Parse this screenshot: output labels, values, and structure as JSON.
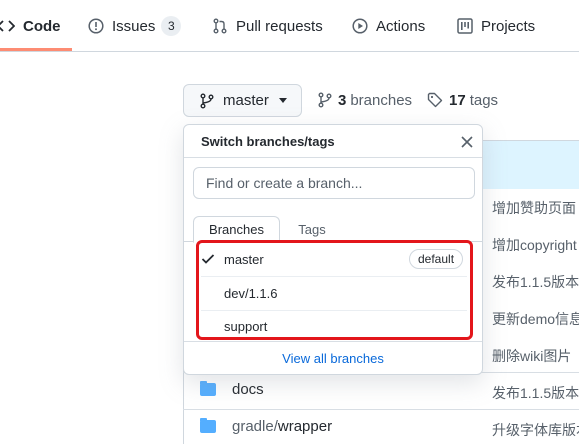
{
  "nav": {
    "code_label": "Code",
    "issues_label": "Issues",
    "issues_count": "3",
    "pulls_label": "Pull requests",
    "actions_label": "Actions",
    "projects_label": "Projects",
    "active_color": "#fd8c73"
  },
  "branch_bar": {
    "current_branch": "master",
    "branches_count": "3",
    "branches_label": "branches",
    "tags_count": "17",
    "tags_label": "tags"
  },
  "dropdown": {
    "title": "Switch branches/tags",
    "filter_placeholder": "Find or create a branch...",
    "tabs": [
      {
        "label": "Branches",
        "selected": true
      },
      {
        "label": "Tags",
        "selected": false
      }
    ],
    "items": [
      {
        "label": "master",
        "checked": true,
        "badge": "default"
      },
      {
        "label": "dev/1.1.6",
        "checked": false,
        "badge": ""
      },
      {
        "label": "support",
        "checked": false,
        "badge": ""
      }
    ],
    "footer_link": "View all branches",
    "highlight_color": "#e3161b"
  },
  "files": {
    "commit_messages": [
      "增加赞助页面",
      "增加copyright",
      "发布1.1.5版本",
      "更新demo信息",
      "删除wiki图片",
      "发布1.1.5版本",
      "升级字体库版本"
    ],
    "rows": [
      {
        "name": "docs"
      },
      {
        "name_prefix": "gradle/",
        "name_suffix": "wrapper"
      }
    ]
  }
}
